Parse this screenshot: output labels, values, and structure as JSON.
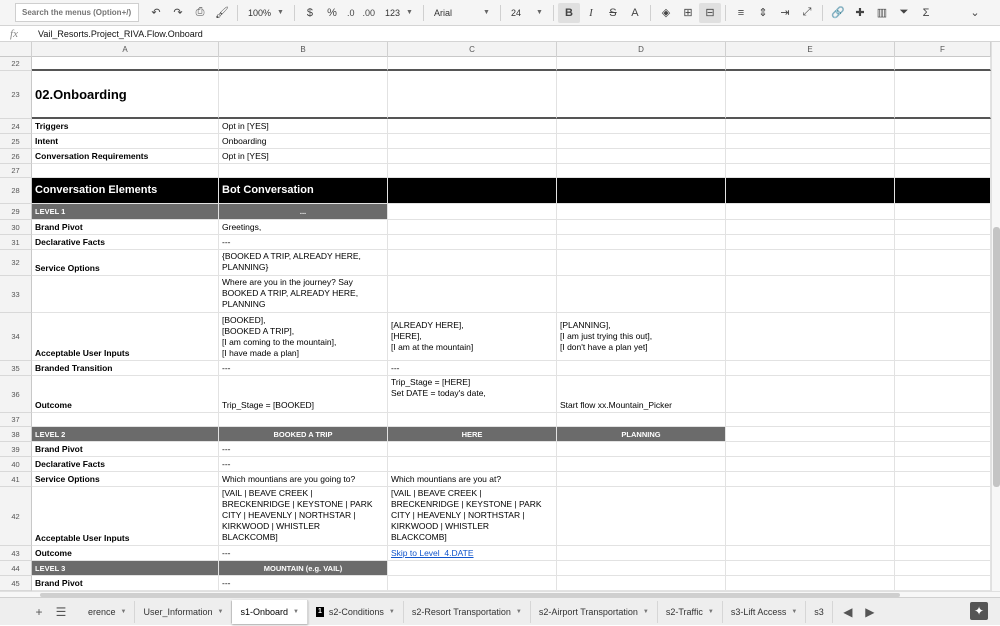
{
  "toolbar": {
    "search_placeholder": "Search the menus (Option+/)",
    "zoom": "100%",
    "currency": "$",
    "percent": "%",
    "dec_less": ".0",
    "dec_more": ".00",
    "number_format": "123",
    "font": "Arial",
    "font_size": "24",
    "bold": "B",
    "italic": "I",
    "strike": "S",
    "text_color": "A",
    "functions": "Σ"
  },
  "formula_bar": {
    "fx": "fx",
    "content": "Vail_Resorts.Project_RIVA.Flow.Onboard"
  },
  "columns": [
    "A",
    "B",
    "C",
    "D",
    "E",
    "F"
  ],
  "rows": [
    {
      "num": "22",
      "cells": []
    },
    {
      "num": "23",
      "cells": [
        {
          "col": 0,
          "text": "02.Onboarding"
        }
      ]
    },
    {
      "num": "24",
      "cells": [
        {
          "col": 0,
          "text": "Triggers"
        },
        {
          "col": 1,
          "text": "Opt in [YES]"
        }
      ]
    },
    {
      "num": "25",
      "cells": [
        {
          "col": 0,
          "text": "Intent"
        },
        {
          "col": 1,
          "text": "Onboarding"
        }
      ]
    },
    {
      "num": "26",
      "cells": [
        {
          "col": 0,
          "text": "Conversation Requirements"
        },
        {
          "col": 1,
          "text": "Opt in [YES]"
        }
      ]
    },
    {
      "num": "27",
      "cells": []
    },
    {
      "num": "28",
      "cells": [
        {
          "col": 0,
          "text": "Conversation Elements"
        },
        {
          "col": 1,
          "text": "Bot Conversation"
        }
      ]
    },
    {
      "num": "29",
      "cells": [
        {
          "col": 0,
          "text": "LEVEL 1"
        },
        {
          "col": 1,
          "text": "..."
        }
      ]
    },
    {
      "num": "30",
      "cells": [
        {
          "col": 0,
          "text": "Brand Pivot"
        },
        {
          "col": 1,
          "text": "Greetings,"
        }
      ]
    },
    {
      "num": "31",
      "cells": [
        {
          "col": 0,
          "text": "Declarative Facts"
        },
        {
          "col": 1,
          "text": "---"
        }
      ]
    },
    {
      "num": "32",
      "cells": [
        {
          "col": 0,
          "text": "Service Options"
        },
        {
          "col": 1,
          "text": "{BOOKED A TRIP, ALREADY HERE,\nPLANNING}"
        }
      ]
    },
    {
      "num": "33",
      "cells": [
        {
          "col": 1,
          "text": "Where are you in the journey? Say\nBOOKED A TRIP, ALREADY HERE,\nPLANNING"
        }
      ]
    },
    {
      "num": "34",
      "cells": [
        {
          "col": 0,
          "text": "Acceptable User Inputs"
        },
        {
          "col": 1,
          "text": "[BOOKED],\n[BOOKED A TRIP],\n[I am coming to the mountain],\n[I have made a plan]"
        },
        {
          "col": 2,
          "text": "[ALREADY HERE],\n[HERE],\n[I am at the mountain]"
        },
        {
          "col": 3,
          "text": "[PLANNING],\n[I am just trying this out],\n[I don't have a plan yet]"
        }
      ]
    },
    {
      "num": "35",
      "cells": [
        {
          "col": 0,
          "text": "Branded Transition"
        },
        {
          "col": 1,
          "text": "---"
        },
        {
          "col": 2,
          "text": "---"
        }
      ]
    },
    {
      "num": "36",
      "cells": [
        {
          "col": 0,
          "text": "Outcome"
        },
        {
          "col": 1,
          "text": "Trip_Stage = [BOOKED]"
        },
        {
          "col": 2,
          "text": "Trip_Stage = [HERE]\nSet DATE = today's date,\n "
        },
        {
          "col": 3,
          "text": "Start flow xx.Mountain_Picker"
        }
      ]
    },
    {
      "num": "37",
      "cells": []
    },
    {
      "num": "38",
      "cells": [
        {
          "col": 0,
          "text": "LEVEL 2"
        },
        {
          "col": 1,
          "text": "BOOKED A TRIP"
        },
        {
          "col": 2,
          "text": "HERE"
        },
        {
          "col": 3,
          "text": "PLANNING"
        }
      ]
    },
    {
      "num": "39",
      "cells": [
        {
          "col": 0,
          "text": "Brand Pivot"
        },
        {
          "col": 1,
          "text": "---"
        }
      ]
    },
    {
      "num": "40",
      "cells": [
        {
          "col": 0,
          "text": "Declarative Facts"
        },
        {
          "col": 1,
          "text": "---"
        }
      ]
    },
    {
      "num": "41",
      "cells": [
        {
          "col": 0,
          "text": "Service Options"
        },
        {
          "col": 1,
          "text": "Which mountians are you going to?"
        },
        {
          "col": 2,
          "text": "Which mountians are you at?"
        }
      ]
    },
    {
      "num": "42",
      "cells": [
        {
          "col": 0,
          "text": "Acceptable User Inputs"
        },
        {
          "col": 1,
          "text": "[VAIL | BEAVE CREEK |\nBRECKENRIDGE | KEYSTONE | PARK\nCITY | HEAVENLY | NORTHSTAR |\nKIRKWOOD | WHISTLER\nBLACKCOMB]"
        },
        {
          "col": 2,
          "text": "[VAIL | BEAVE CREEK |\nBRECKENRIDGE | KEYSTONE | PARK\nCITY | HEAVENLY | NORTHSTAR |\nKIRKWOOD | WHISTLER\nBLACKCOMB]"
        }
      ]
    },
    {
      "num": "43",
      "cells": [
        {
          "col": 0,
          "text": "Outcome"
        },
        {
          "col": 1,
          "text": "---"
        },
        {
          "col": 2,
          "text": "Skip to Level_4.DATE"
        }
      ]
    },
    {
      "num": "44",
      "cells": [
        {
          "col": 0,
          "text": "LEVEL 3"
        },
        {
          "col": 1,
          "text": "MOUNTAIN (e.g. VAIL)"
        }
      ]
    },
    {
      "num": "45",
      "cells": [
        {
          "col": 0,
          "text": "Brand Pivot"
        },
        {
          "col": 1,
          "text": "---"
        }
      ]
    }
  ],
  "sheet_tabs": [
    {
      "label": "erence",
      "active": false
    },
    {
      "label": "User_Information",
      "active": false
    },
    {
      "label": "s1-Onboard",
      "active": true
    },
    {
      "label": "s2-Conditions",
      "active": false,
      "badge": "1"
    },
    {
      "label": "s2-Resort Transportation",
      "active": false
    },
    {
      "label": "s2-Airport Transportation",
      "active": false
    },
    {
      "label": "s2-Traffic",
      "active": false
    },
    {
      "label": "s3-Lift Access",
      "active": false
    },
    {
      "label": "s3",
      "active": false
    }
  ]
}
